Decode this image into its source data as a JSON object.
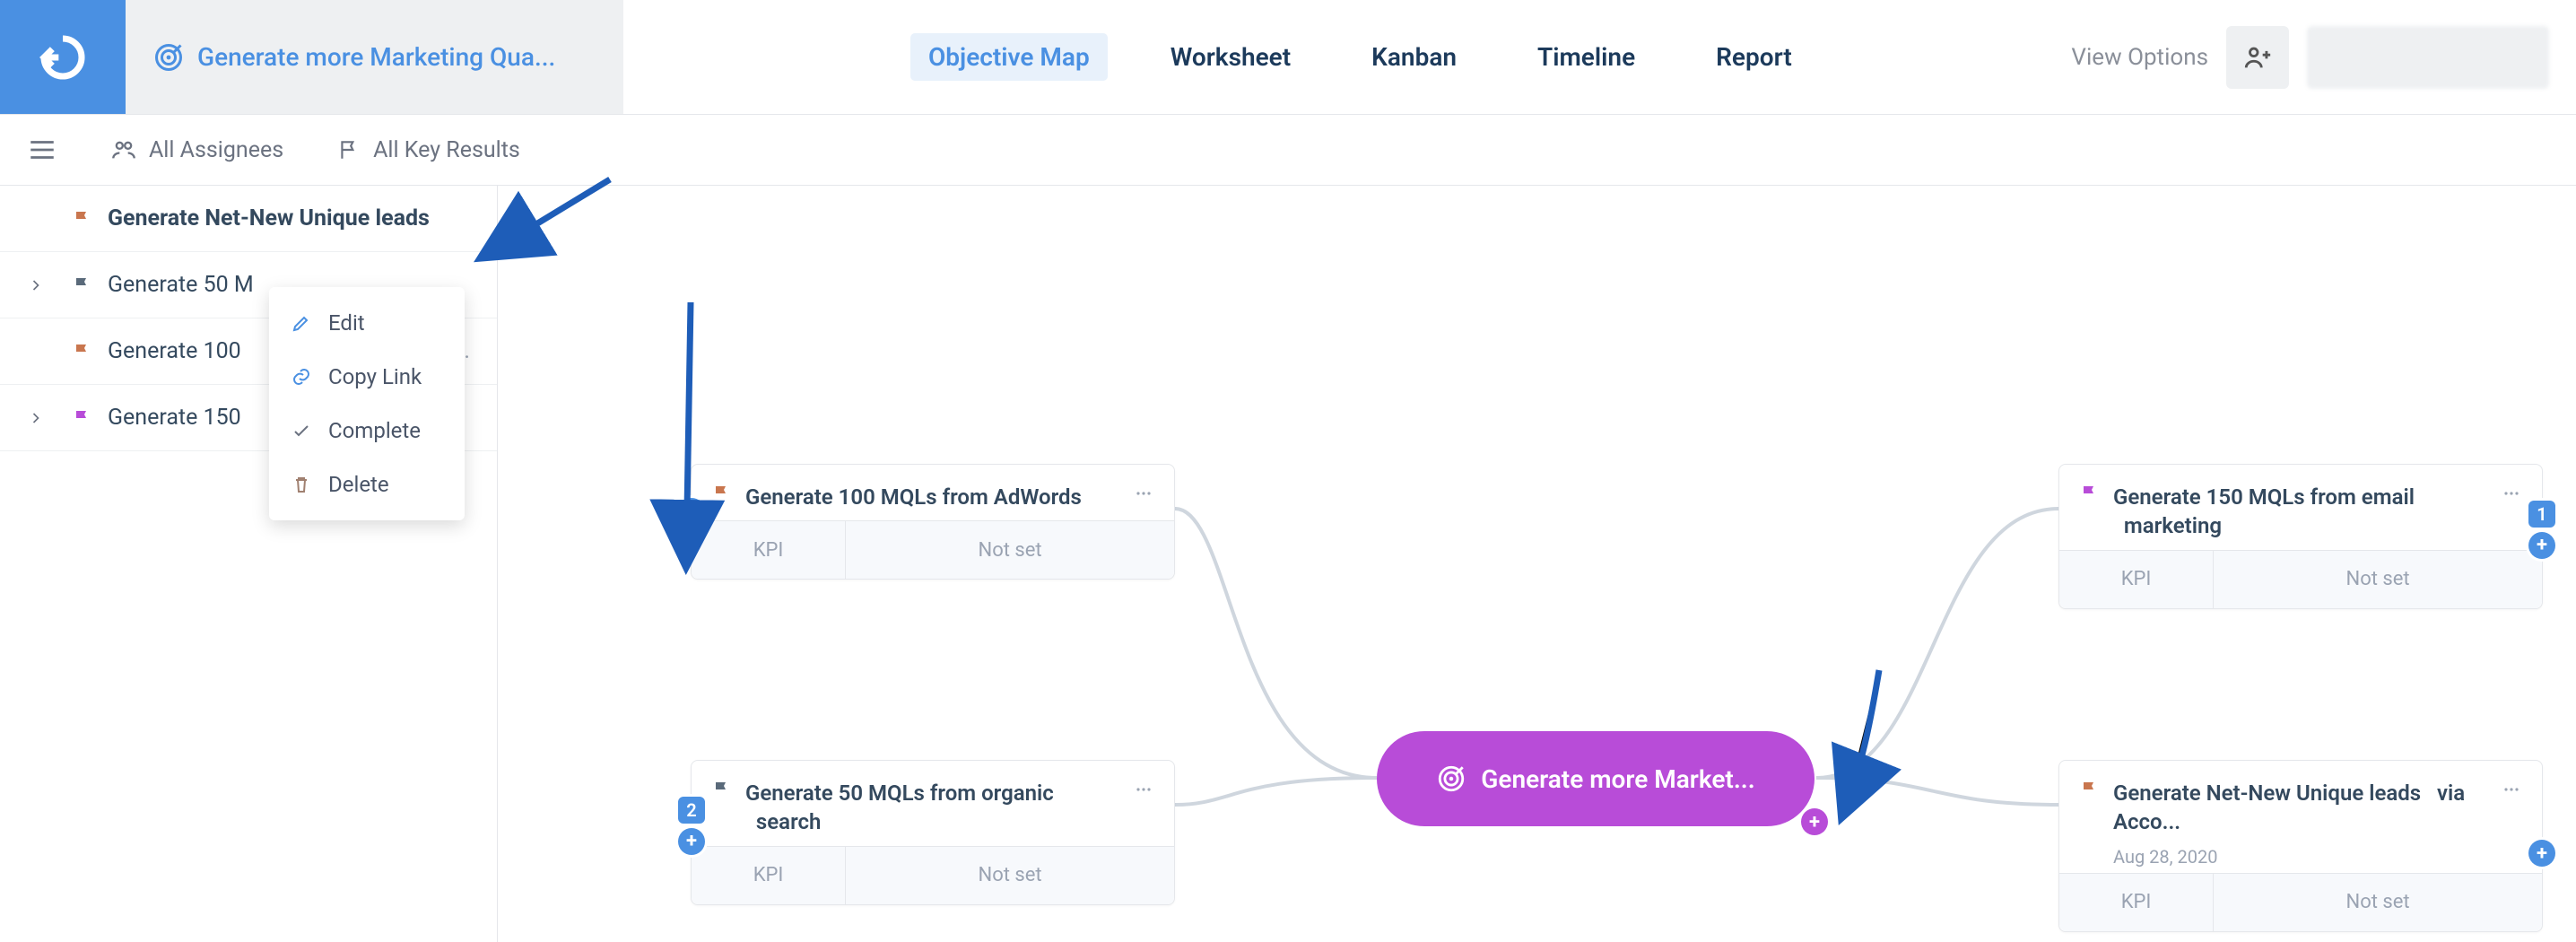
{
  "header": {
    "title": "Generate more Marketing Qua...",
    "tabs": [
      "Objective Map",
      "Worksheet",
      "Kanban",
      "Timeline",
      "Report"
    ],
    "active_tab": 0,
    "view_options": "View Options"
  },
  "subbar": {
    "assignees": "All Assignees",
    "key_results": "All Key Results"
  },
  "sidebar": {
    "items": [
      {
        "label": "Generate Net-New Unique leads",
        "flag": "#c9764e",
        "expandable": false,
        "bold": true
      },
      {
        "label": "Generate 50 M",
        "flag": "#5a6a7a",
        "expandable": true,
        "bold": false
      },
      {
        "label": "Generate 100",
        "flag": "#c9764e",
        "trail": "o...",
        "expandable": false,
        "bold": false
      },
      {
        "label": "Generate 150",
        "flag": "#b84cd8",
        "expandable": true,
        "bold": false
      }
    ]
  },
  "context_menu": {
    "items": [
      "Edit",
      "Copy Link",
      "Complete",
      "Delete"
    ]
  },
  "nodes": {
    "n1": {
      "title": "Generate 100 MQLs from AdWords",
      "flag": "#c9764e",
      "kpi_label": "KPI",
      "kpi_value": "Not set"
    },
    "n2": {
      "title": "Generate 50 MQLs from organic   search",
      "flag": "#5a6a7a",
      "kpi_label": "KPI",
      "kpi_value": "Not set",
      "badge": "2"
    },
    "n3": {
      "title": "Generate 150 MQLs from email   marketing",
      "flag": "#b84cd8",
      "kpi_label": "KPI",
      "kpi_value": "Not set",
      "badge": "1"
    },
    "n4": {
      "title": "Generate Net-New Unique leads   via Acco...",
      "flag": "#c9764e",
      "kpi_label": "KPI",
      "kpi_value": "Not set",
      "date": "Aug 28, 2020"
    }
  },
  "center": {
    "label": "Generate more Market..."
  }
}
